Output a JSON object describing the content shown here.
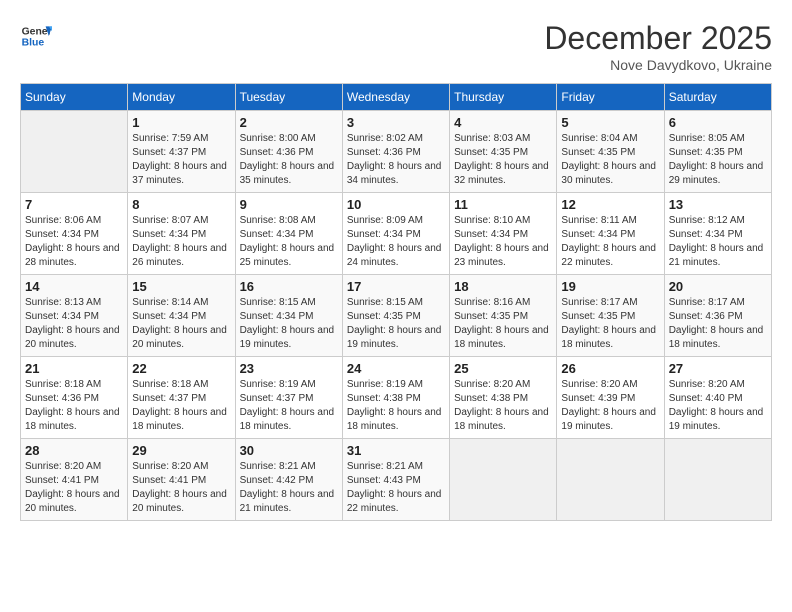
{
  "header": {
    "logo_line1": "General",
    "logo_line2": "Blue",
    "month": "December 2025",
    "location": "Nove Davydkovo, Ukraine"
  },
  "weekdays": [
    "Sunday",
    "Monday",
    "Tuesday",
    "Wednesday",
    "Thursday",
    "Friday",
    "Saturday"
  ],
  "weeks": [
    [
      {
        "day": "",
        "sunrise": "",
        "sunset": "",
        "daylight": ""
      },
      {
        "day": "1",
        "sunrise": "Sunrise: 7:59 AM",
        "sunset": "Sunset: 4:37 PM",
        "daylight": "Daylight: 8 hours and 37 minutes."
      },
      {
        "day": "2",
        "sunrise": "Sunrise: 8:00 AM",
        "sunset": "Sunset: 4:36 PM",
        "daylight": "Daylight: 8 hours and 35 minutes."
      },
      {
        "day": "3",
        "sunrise": "Sunrise: 8:02 AM",
        "sunset": "Sunset: 4:36 PM",
        "daylight": "Daylight: 8 hours and 34 minutes."
      },
      {
        "day": "4",
        "sunrise": "Sunrise: 8:03 AM",
        "sunset": "Sunset: 4:35 PM",
        "daylight": "Daylight: 8 hours and 32 minutes."
      },
      {
        "day": "5",
        "sunrise": "Sunrise: 8:04 AM",
        "sunset": "Sunset: 4:35 PM",
        "daylight": "Daylight: 8 hours and 30 minutes."
      },
      {
        "day": "6",
        "sunrise": "Sunrise: 8:05 AM",
        "sunset": "Sunset: 4:35 PM",
        "daylight": "Daylight: 8 hours and 29 minutes."
      }
    ],
    [
      {
        "day": "7",
        "sunrise": "Sunrise: 8:06 AM",
        "sunset": "Sunset: 4:34 PM",
        "daylight": "Daylight: 8 hours and 28 minutes."
      },
      {
        "day": "8",
        "sunrise": "Sunrise: 8:07 AM",
        "sunset": "Sunset: 4:34 PM",
        "daylight": "Daylight: 8 hours and 26 minutes."
      },
      {
        "day": "9",
        "sunrise": "Sunrise: 8:08 AM",
        "sunset": "Sunset: 4:34 PM",
        "daylight": "Daylight: 8 hours and 25 minutes."
      },
      {
        "day": "10",
        "sunrise": "Sunrise: 8:09 AM",
        "sunset": "Sunset: 4:34 PM",
        "daylight": "Daylight: 8 hours and 24 minutes."
      },
      {
        "day": "11",
        "sunrise": "Sunrise: 8:10 AM",
        "sunset": "Sunset: 4:34 PM",
        "daylight": "Daylight: 8 hours and 23 minutes."
      },
      {
        "day": "12",
        "sunrise": "Sunrise: 8:11 AM",
        "sunset": "Sunset: 4:34 PM",
        "daylight": "Daylight: 8 hours and 22 minutes."
      },
      {
        "day": "13",
        "sunrise": "Sunrise: 8:12 AM",
        "sunset": "Sunset: 4:34 PM",
        "daylight": "Daylight: 8 hours and 21 minutes."
      }
    ],
    [
      {
        "day": "14",
        "sunrise": "Sunrise: 8:13 AM",
        "sunset": "Sunset: 4:34 PM",
        "daylight": "Daylight: 8 hours and 20 minutes."
      },
      {
        "day": "15",
        "sunrise": "Sunrise: 8:14 AM",
        "sunset": "Sunset: 4:34 PM",
        "daylight": "Daylight: 8 hours and 20 minutes."
      },
      {
        "day": "16",
        "sunrise": "Sunrise: 8:15 AM",
        "sunset": "Sunset: 4:34 PM",
        "daylight": "Daylight: 8 hours and 19 minutes."
      },
      {
        "day": "17",
        "sunrise": "Sunrise: 8:15 AM",
        "sunset": "Sunset: 4:35 PM",
        "daylight": "Daylight: 8 hours and 19 minutes."
      },
      {
        "day": "18",
        "sunrise": "Sunrise: 8:16 AM",
        "sunset": "Sunset: 4:35 PM",
        "daylight": "Daylight: 8 hours and 18 minutes."
      },
      {
        "day": "19",
        "sunrise": "Sunrise: 8:17 AM",
        "sunset": "Sunset: 4:35 PM",
        "daylight": "Daylight: 8 hours and 18 minutes."
      },
      {
        "day": "20",
        "sunrise": "Sunrise: 8:17 AM",
        "sunset": "Sunset: 4:36 PM",
        "daylight": "Daylight: 8 hours and 18 minutes."
      }
    ],
    [
      {
        "day": "21",
        "sunrise": "Sunrise: 8:18 AM",
        "sunset": "Sunset: 4:36 PM",
        "daylight": "Daylight: 8 hours and 18 minutes."
      },
      {
        "day": "22",
        "sunrise": "Sunrise: 8:18 AM",
        "sunset": "Sunset: 4:37 PM",
        "daylight": "Daylight: 8 hours and 18 minutes."
      },
      {
        "day": "23",
        "sunrise": "Sunrise: 8:19 AM",
        "sunset": "Sunset: 4:37 PM",
        "daylight": "Daylight: 8 hours and 18 minutes."
      },
      {
        "day": "24",
        "sunrise": "Sunrise: 8:19 AM",
        "sunset": "Sunset: 4:38 PM",
        "daylight": "Daylight: 8 hours and 18 minutes."
      },
      {
        "day": "25",
        "sunrise": "Sunrise: 8:20 AM",
        "sunset": "Sunset: 4:38 PM",
        "daylight": "Daylight: 8 hours and 18 minutes."
      },
      {
        "day": "26",
        "sunrise": "Sunrise: 8:20 AM",
        "sunset": "Sunset: 4:39 PM",
        "daylight": "Daylight: 8 hours and 19 minutes."
      },
      {
        "day": "27",
        "sunrise": "Sunrise: 8:20 AM",
        "sunset": "Sunset: 4:40 PM",
        "daylight": "Daylight: 8 hours and 19 minutes."
      }
    ],
    [
      {
        "day": "28",
        "sunrise": "Sunrise: 8:20 AM",
        "sunset": "Sunset: 4:41 PM",
        "daylight": "Daylight: 8 hours and 20 minutes."
      },
      {
        "day": "29",
        "sunrise": "Sunrise: 8:20 AM",
        "sunset": "Sunset: 4:41 PM",
        "daylight": "Daylight: 8 hours and 20 minutes."
      },
      {
        "day": "30",
        "sunrise": "Sunrise: 8:21 AM",
        "sunset": "Sunset: 4:42 PM",
        "daylight": "Daylight: 8 hours and 21 minutes."
      },
      {
        "day": "31",
        "sunrise": "Sunrise: 8:21 AM",
        "sunset": "Sunset: 4:43 PM",
        "daylight": "Daylight: 8 hours and 22 minutes."
      },
      {
        "day": "",
        "sunrise": "",
        "sunset": "",
        "daylight": ""
      },
      {
        "day": "",
        "sunrise": "",
        "sunset": "",
        "daylight": ""
      },
      {
        "day": "",
        "sunrise": "",
        "sunset": "",
        "daylight": ""
      }
    ]
  ]
}
